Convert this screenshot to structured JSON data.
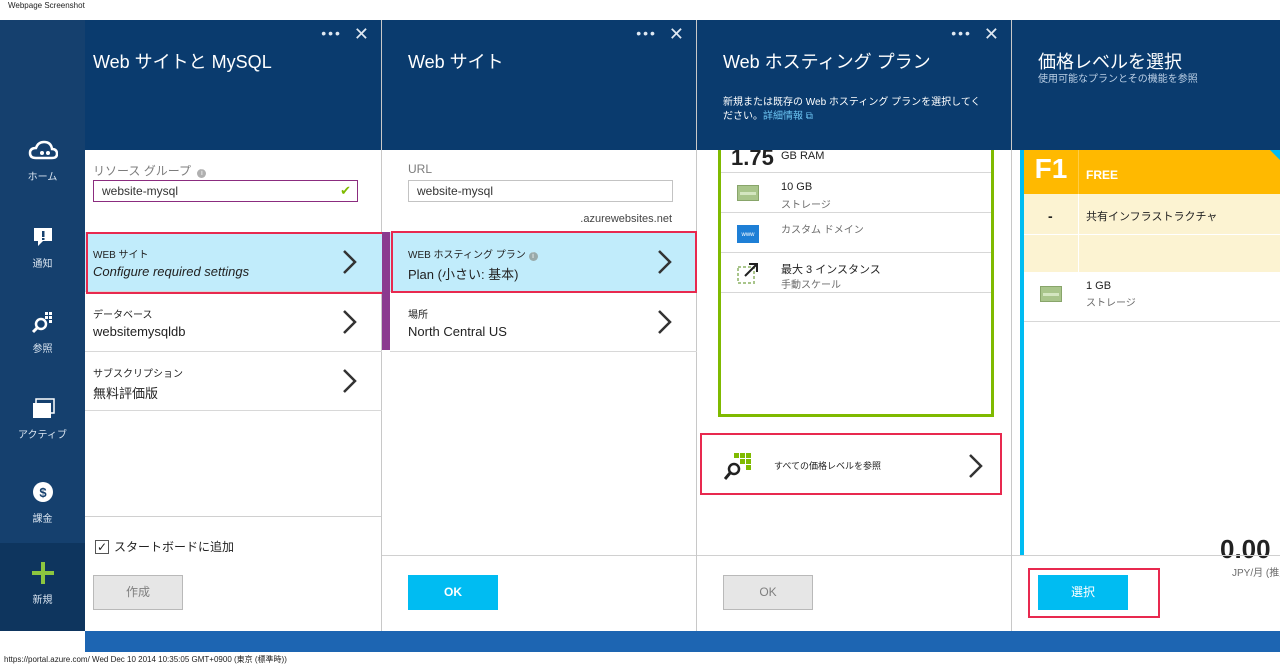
{
  "window": {
    "title": "Webpage Screenshot",
    "status": "https://portal.azure.com/ Wed Dec 10 2014 10:35:05 GMT+0900 (東京 (標準時))"
  },
  "sidebar": {
    "items": [
      {
        "label": "ホーム",
        "icon": "cloud-icon"
      },
      {
        "label": "通知",
        "icon": "notification-icon"
      },
      {
        "label": "参照",
        "icon": "browse-icon"
      },
      {
        "label": "アクティブ",
        "icon": "active-icon"
      },
      {
        "label": "課金",
        "icon": "billing-icon"
      }
    ],
    "new_label": "新規"
  },
  "blade1": {
    "title": "Web サイトと MySQL",
    "resource_group_label": "リソース グループ",
    "resource_group_value": "website-mysql",
    "rows": [
      {
        "label": "WEB サイト",
        "value": "Configure required settings"
      },
      {
        "label": "データベース",
        "value": "websitemysqldb"
      },
      {
        "label": "サブスクリプション",
        "value": "無料評価版"
      }
    ],
    "startboard_label": "スタートボードに追加",
    "create_label": "作成"
  },
  "blade2": {
    "title": "Web サイト",
    "url_label": "URL",
    "url_value": "website-mysql",
    "url_suffix": ".azurewebsites.net",
    "rows": [
      {
        "label": "WEB ホスティング プラン",
        "value": "Plan (小さい: 基本)"
      },
      {
        "label": "場所",
        "value": "North Central US"
      }
    ],
    "ok_label": "OK"
  },
  "blade3": {
    "title": "Web ホスティング プラン",
    "desc_line1": "新規または既存の Web ホスティング プランを選択してく",
    "desc_line2": "ださい。",
    "details_link": "詳細情報",
    "ram_value": "1.75",
    "ram_unit": "GB RAM",
    "features": [
      {
        "title": "10 GB",
        "sub": "ストレージ"
      },
      {
        "title": "",
        "sub": "カスタム ドメイン"
      },
      {
        "title": "最大 3 インスタンス",
        "sub": "手動スケール"
      }
    ],
    "browse_all_label": "すべての価格レベルを参照",
    "ok_label": "OK"
  },
  "blade4": {
    "title": "価格レベルを選択",
    "subtitle": "使用可能なプランとその機能を参照",
    "tier_code": "F1",
    "tier_name": "FREE",
    "features": [
      {
        "mark": "-",
        "title": "共有インフラストラクチャ"
      },
      {
        "title": "1 GB",
        "sub": "ストレージ"
      }
    ],
    "price": "0.00",
    "price_unit": "JPY/月 (推定",
    "select_label": "選択"
  },
  "colors": {
    "header_bg": "#0a3b6e",
    "sidebar_bg": "#15406e",
    "accent": "#00bcf2",
    "highlight_border": "#e8294f",
    "selected_row": "#c1ecfb",
    "tier_yellow": "#ffb900",
    "plan_green": "#7fba00"
  }
}
